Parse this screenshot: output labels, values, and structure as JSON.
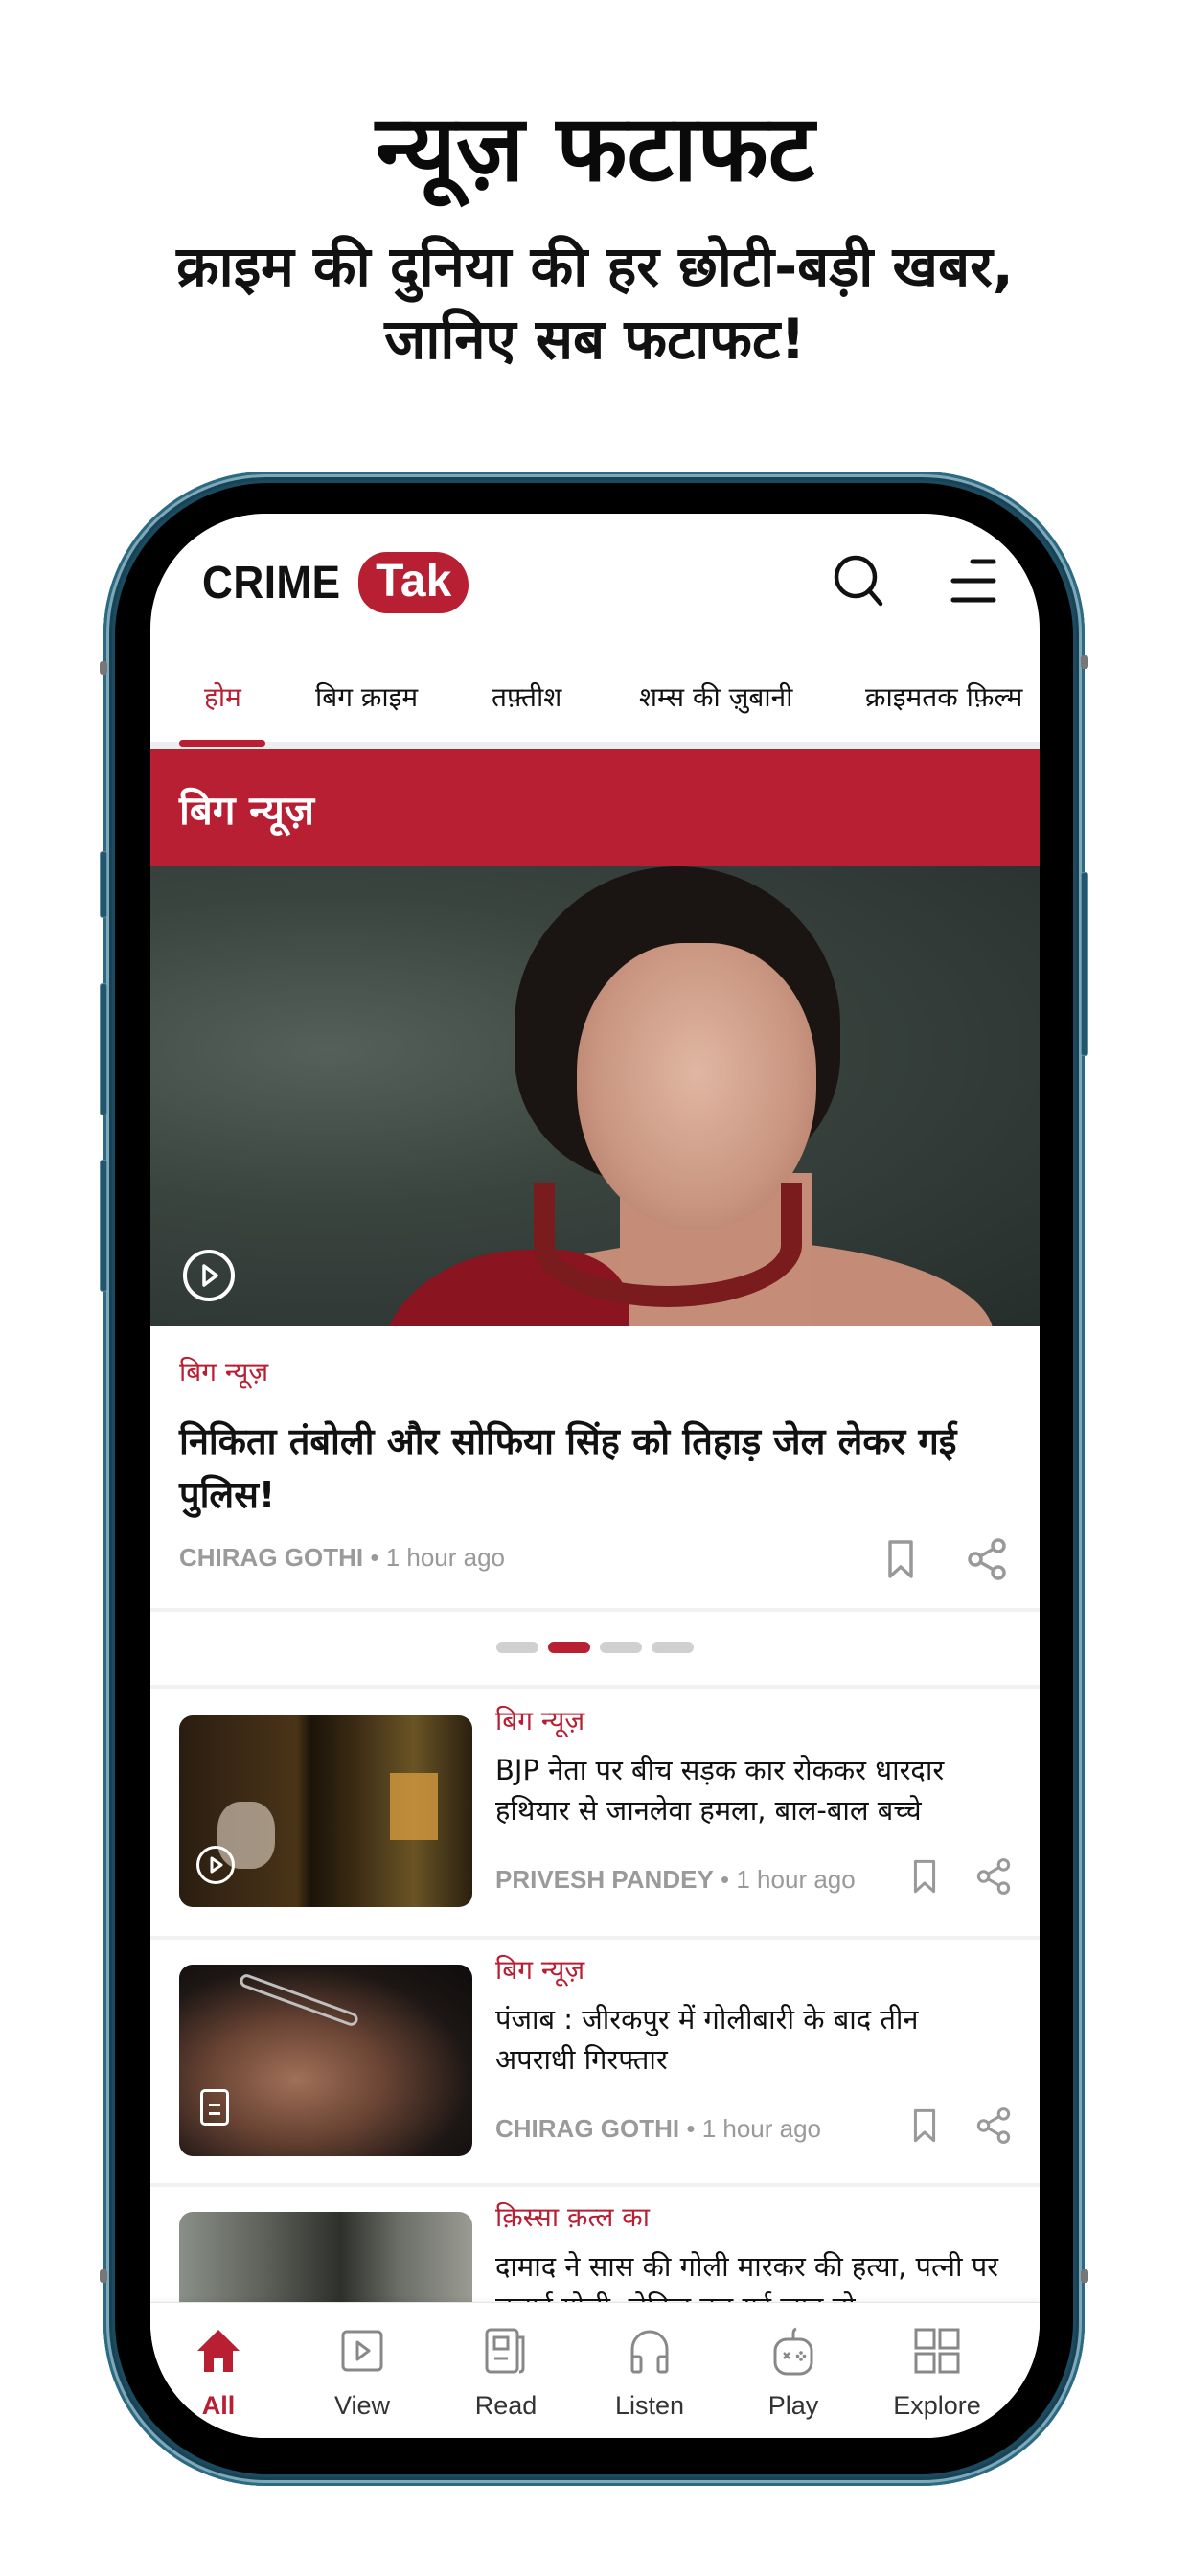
{
  "promo": {
    "title": "न्यूज़ फटाफट",
    "subtitle_line1": "क्राइम की दुनिया की हर छोटी-बड़ी खबर,",
    "subtitle_line2": "जानिए सब फटाफट!"
  },
  "app": {
    "logo_primary": "CRIME",
    "logo_secondary": "Tak",
    "brand_color": "#b81f33",
    "header_icons": [
      "search-icon",
      "menu-icon"
    ]
  },
  "tabs": [
    {
      "label": "होम",
      "active": true
    },
    {
      "label": "बिग क्राइम",
      "active": false
    },
    {
      "label": "तफ़्तीश",
      "active": false
    },
    {
      "label": "शम्स की ज़ुबानी",
      "active": false
    },
    {
      "label": "क्राइमतक फ़िल्म",
      "active": false
    }
  ],
  "section": {
    "title": "बिग न्यूज़"
  },
  "hero": {
    "media_type": "video",
    "category": "बिग न्यूज़",
    "headline": "निकिता तंबोली और सोफिया सिंह को तिहाड़ जेल लेकर गई पुलिस!",
    "author": "CHIRAG GOTHI",
    "time": "1 hour ago",
    "separator": "•"
  },
  "carousel": {
    "total": 4,
    "active_index": 1
  },
  "articles": [
    {
      "media_type": "video",
      "category": "बिग न्यूज़",
      "title": "BJP नेता पर बीच सड़क कार रोककर धारदार हथियार से जानलेवा हमला, बाल-बाल बच्चे",
      "author": "PRIVESH PANDEY",
      "time": "1 hour ago"
    },
    {
      "media_type": "article",
      "category": "बिग न्यूज़",
      "title": "पंजाब : जीरकपुर में गोलीबारी के बाद तीन अपराधी गिरफ्तार",
      "author": "CHIRAG GOTHI",
      "time": "1 hour ago"
    },
    {
      "media_type": "image",
      "category": "क़िस्सा क़त्ल का",
      "title": "दामाद ने सास की गोली मारकर की हत्या, पत्नी पर चलाई गोली, लेकिन बच गई जान तो"
    }
  ],
  "bottom_nav": [
    {
      "label": "All",
      "icon": "home-icon",
      "active": true
    },
    {
      "label": "View",
      "icon": "video-icon",
      "active": false
    },
    {
      "label": "Read",
      "icon": "newspaper-icon",
      "active": false
    },
    {
      "label": "Listen",
      "icon": "headphones-icon",
      "active": false
    },
    {
      "label": "Play",
      "icon": "gamepad-icon",
      "active": false
    },
    {
      "label": "Explore",
      "icon": "grid-icon",
      "active": false
    }
  ]
}
